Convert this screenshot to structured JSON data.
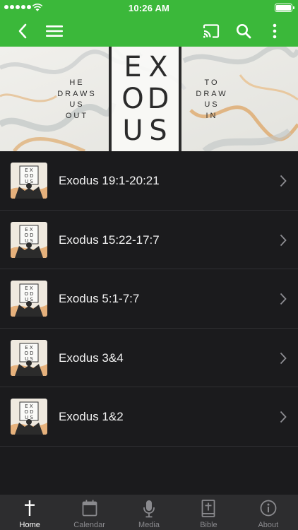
{
  "status_bar": {
    "time": "10:26 AM"
  },
  "app_bar": {
    "accent_color": "#3bb83a",
    "icons": [
      "back-icon",
      "menu-icon",
      "cast-icon",
      "search-icon",
      "more-vertical-icon"
    ]
  },
  "banner": {
    "title_letters": [
      "E",
      "X",
      "O",
      "D",
      "U",
      "S"
    ],
    "left_text": [
      "HE",
      "DRAWS",
      "US",
      "OUT"
    ],
    "right_text": [
      "TO",
      "DRAW",
      "US",
      "IN"
    ]
  },
  "sermons": [
    {
      "title": "Exodus 19:1-20:21"
    },
    {
      "title": "Exodus 15:22-17:7"
    },
    {
      "title": "Exodus 5:1-7:7"
    },
    {
      "title": "Exodus 3&4"
    },
    {
      "title": "Exodus 1&2"
    }
  ],
  "tabs": [
    {
      "label": "Home",
      "icon": "cross-icon",
      "active": true
    },
    {
      "label": "Calendar",
      "icon": "calendar-icon",
      "active": false
    },
    {
      "label": "Media",
      "icon": "microphone-icon",
      "active": false
    },
    {
      "label": "Bible",
      "icon": "bible-icon",
      "active": false
    },
    {
      "label": "About",
      "icon": "info-icon",
      "active": false
    }
  ]
}
